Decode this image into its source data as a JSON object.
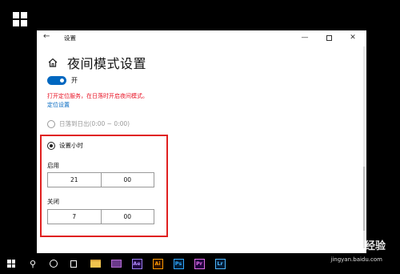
{
  "window": {
    "title": "设置",
    "back_icon": "arrow-left-icon",
    "minimize_icon": "minimize-icon",
    "maximize_icon": "maximize-icon",
    "close_icon": "close-icon"
  },
  "page": {
    "title": "夜间模式设置",
    "home_icon": "home-icon"
  },
  "toggle": {
    "state_label": "开",
    "on": true,
    "accent": "#0067c0"
  },
  "warning": {
    "text": "打开定位服务，在日落时开启夜间模式。",
    "color": "#e81123"
  },
  "location_link": "定位设置",
  "schedule": {
    "option_sunset": "日落到日出(0:00 ~ 0:00)",
    "option_custom": "设置小时",
    "selected": "设置小时"
  },
  "turn_on": {
    "label": "启用",
    "hour": "21",
    "minute": "00"
  },
  "turn_off": {
    "label": "关闭",
    "hour": "7",
    "minute": "00"
  },
  "highlight_color": "#e02020",
  "taskbar": {
    "apps": [
      "Ae",
      "Ai",
      "Ps",
      "Pr",
      "Lr"
    ]
  },
  "watermark": {
    "brand": "Bai 经验",
    "url": "jingyan.baidu.com"
  }
}
